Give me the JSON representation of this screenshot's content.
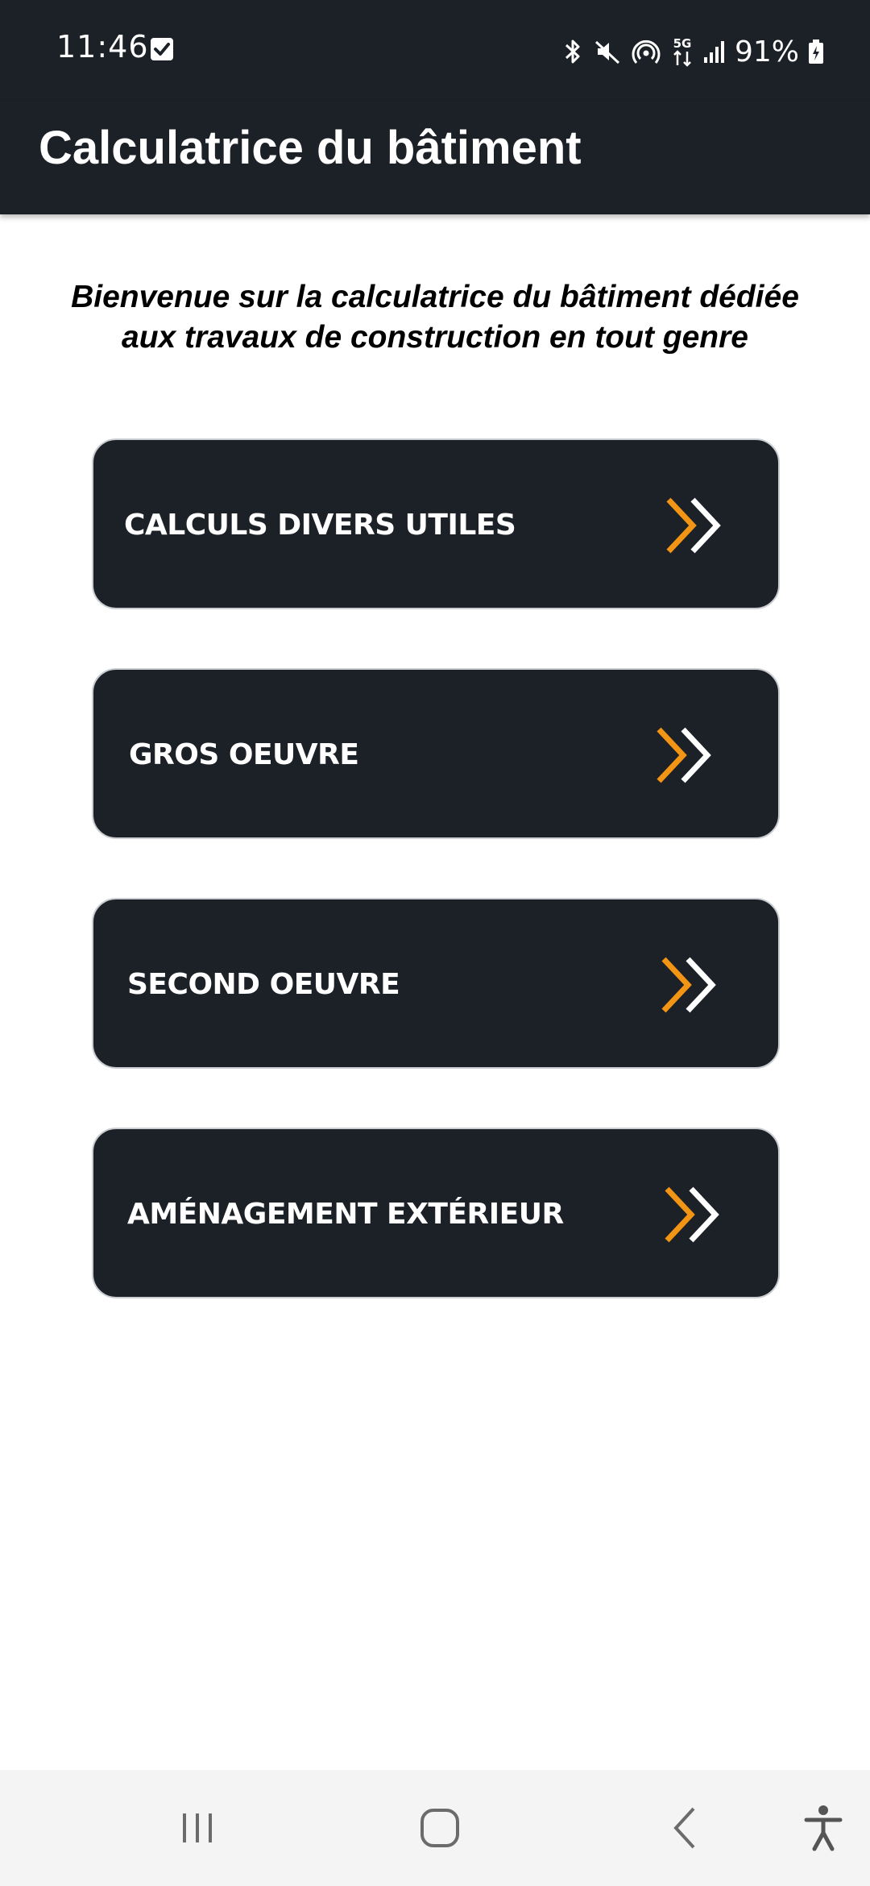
{
  "status_bar": {
    "time": "11:46",
    "battery": "91%",
    "network": "5G",
    "icons": [
      "checkbox-icon",
      "bluetooth-icon",
      "mute-icon",
      "hotspot-icon",
      "5g-data-icon",
      "signal-icon",
      "battery-charging-icon"
    ]
  },
  "app_bar": {
    "title": "Calculatrice du bâtiment"
  },
  "welcome": {
    "line1": "Bienvenue sur la calculatrice du bâtiment dédiée",
    "line2": "aux travaux de construction en tout genre"
  },
  "menu": {
    "items": [
      {
        "label": "CALCULS DIVERS UTILES",
        "icon": "double-chevron-right-icon"
      },
      {
        "label": "GROS OEUVRE",
        "icon": "double-chevron-right-icon"
      },
      {
        "label": "SECOND OEUVRE",
        "icon": "double-chevron-right-icon"
      },
      {
        "label": "AMÉNAGEMENT EXTÉRIEUR",
        "icon": "double-chevron-right-icon"
      }
    ]
  },
  "nav_bar": {
    "icons": [
      "recent-apps-icon",
      "home-icon",
      "back-icon",
      "accessibility-icon"
    ]
  },
  "colors": {
    "bar": "#1c2127",
    "button": "#1c2127",
    "accent_orange": "#f29414",
    "chevron_white": "#ffffff",
    "text_primary": "#000000",
    "nav_background": "#f4f4f4"
  }
}
